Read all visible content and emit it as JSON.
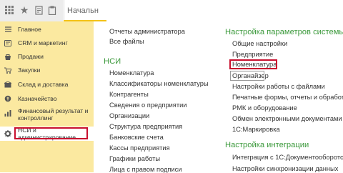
{
  "toolbar": {
    "tab_label": "Начальн",
    "icons": [
      "apps-grid-icon",
      "favorites-star-icon",
      "history-icon",
      "clipboard-icon"
    ]
  },
  "sidebar": {
    "items": [
      {
        "label": "Главное",
        "icon": "menu-lines-icon"
      },
      {
        "label": "CRM и маркетинг",
        "icon": "crm-icon"
      },
      {
        "label": "Продажи",
        "icon": "sales-icon"
      },
      {
        "label": "Закупки",
        "icon": "purchases-icon"
      },
      {
        "label": "Склад и доставка",
        "icon": "warehouse-icon"
      },
      {
        "label": "Казначейство",
        "icon": "treasury-icon"
      },
      {
        "label": "Финансовый результат и контроллинг",
        "icon": "finance-icon"
      },
      {
        "label": "НСИ и администрирование",
        "icon": "gear-icon"
      }
    ],
    "active_index": 7
  },
  "main": {
    "left_top": [
      "Отчеты администратора",
      "Все файлы"
    ],
    "nsi_heading": "НСИ",
    "nsi_items": [
      "Номенклатура",
      "Классификаторы номенклатуры",
      "Контрагенты",
      "Сведения о предприятии",
      "Организации",
      "Структура предприятия",
      "Банковские счета",
      "Кассы предприятия",
      "Графики работы",
      "Лица с правом подписи"
    ],
    "settings_heading": "Настройка параметров системы",
    "settings_items": [
      "Общие настройки",
      "Предприятие",
      "Номенклатура",
      "Органайзер",
      "Настройки работы с файлами",
      "Печатные формы, отчеты и обработки",
      "РМК и оборудование",
      "Обмен электронными документами",
      "1С:Маркировка"
    ],
    "integration_heading": "Настройка интеграции",
    "integration_items": [
      "Интеграция с 1С:Документооборотом",
      "Настройки синхронизации данных"
    ]
  },
  "colors": {
    "sidebar_bg": "#fbe9a0",
    "heading_green": "#3d9a3d",
    "highlight_red": "#c8102e",
    "tab_accent": "#f3c218"
  }
}
